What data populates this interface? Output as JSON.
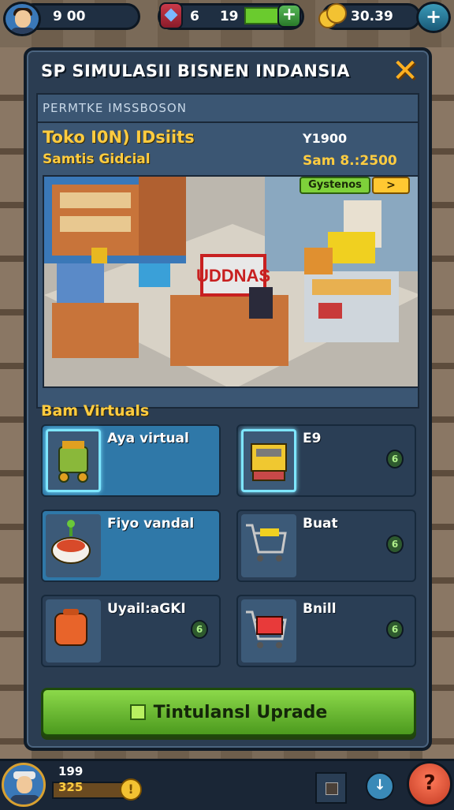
{
  "top_bar": {
    "currency_1": "9 00",
    "gem_count": "6",
    "energy_value": "19",
    "coins": "30.39",
    "plus_glyph": "+"
  },
  "panel": {
    "title": "SP SIMULASII BISNEN INDANSIA",
    "close_glyph": "✕",
    "info": {
      "subtitle": "PERMTKE IMSSBOSON",
      "store_name": "Toko I0N) IDsiits",
      "store_subtitle": "Samtis Gidcial",
      "value_1": "Y1900",
      "value_2": "Sam 8.:2500",
      "systems_label": "Gystenos",
      "systems_tag": ">"
    },
    "scene": {
      "sign_text": "UDDNAS"
    },
    "section_title": "Bam Virtuals",
    "items": [
      {
        "label": "Aya virtual",
        "highlight": true,
        "selected": true,
        "icon": "virtual-cart-icon",
        "badge": ""
      },
      {
        "label": "E9",
        "highlight": false,
        "selected": true,
        "icon": "shopping-basket-icon",
        "badge": "6"
      },
      {
        "label": "Fiyo vandal",
        "highlight": true,
        "selected": false,
        "icon": "food-bowl-icon",
        "badge": ""
      },
      {
        "label": "Buat",
        "highlight": false,
        "selected": false,
        "icon": "shopping-cart-icon",
        "badge": "6"
      },
      {
        "label": "Uyail:aGKI",
        "highlight": false,
        "selected": false,
        "icon": "toaster-icon",
        "badge": "6"
      },
      {
        "label": "Bnill",
        "highlight": false,
        "selected": false,
        "icon": "cart-box-icon",
        "badge": "6"
      }
    ],
    "upgrade_button": "Tintulansl  Uprade"
  },
  "bottom_bar": {
    "stat_1": "199",
    "stat_2": "325",
    "coin_glyph": "!",
    "down_glyph": "↓",
    "help_glyph": "?"
  },
  "colors": {
    "panel": "#2b3d52",
    "accent_yellow": "#ffcc40",
    "button_green": "#6ec03a",
    "highlight_blue": "#2f78a8"
  }
}
